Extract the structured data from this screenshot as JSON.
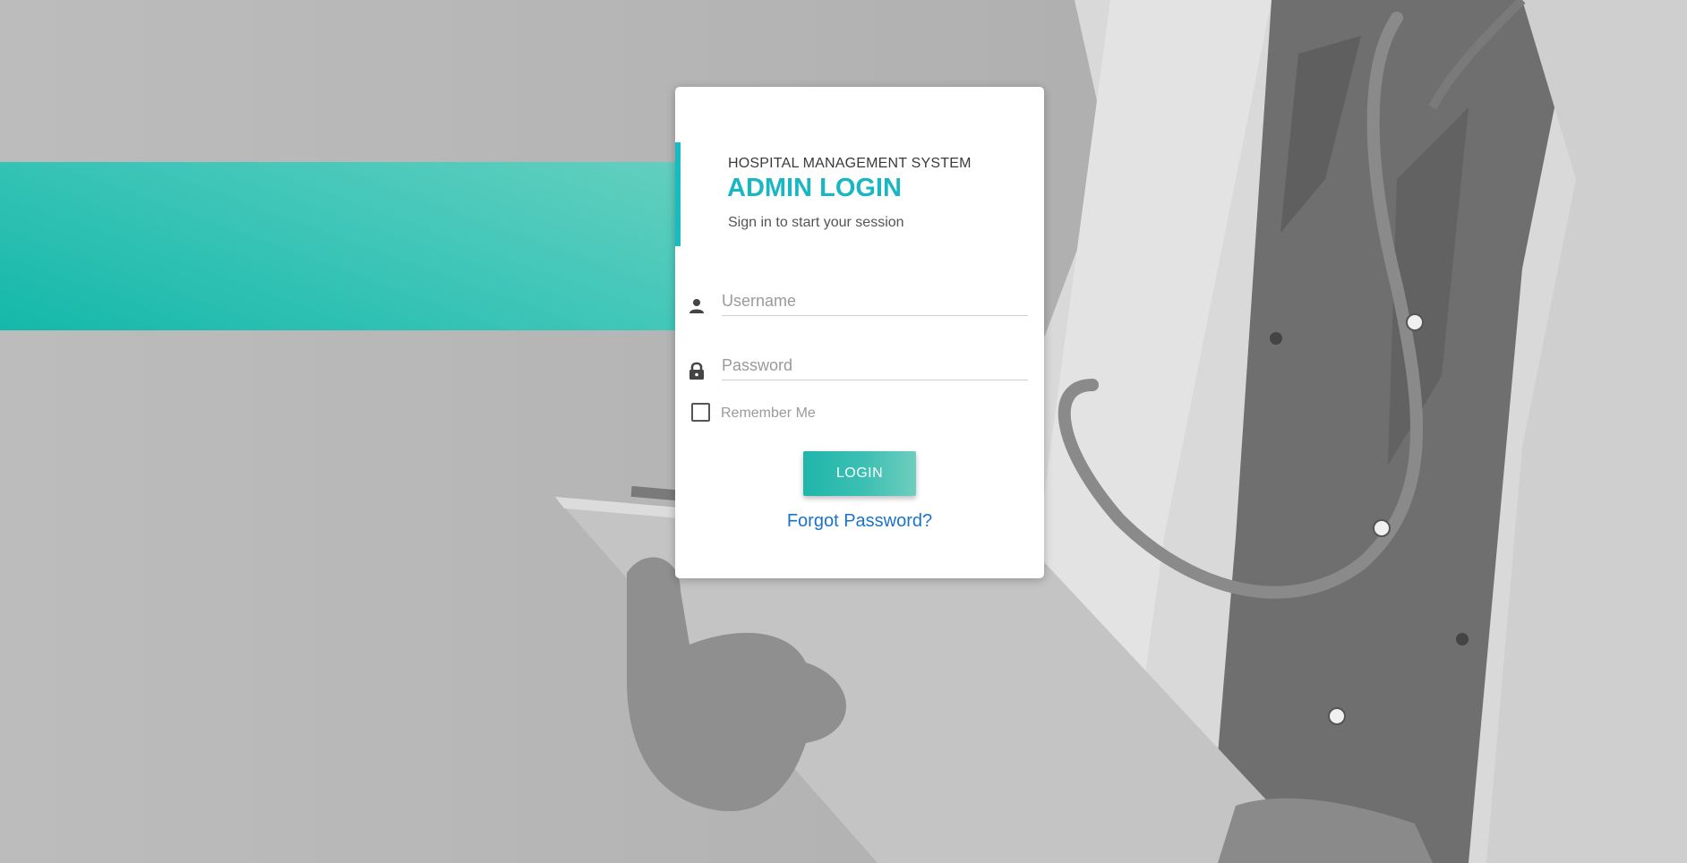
{
  "background": {
    "accent_color": "#1ab7c3",
    "band_color": "#3fc6b8"
  },
  "login": {
    "system_name": "HOSPITAL MANAGEMENT SYSTEM",
    "title": "ADMIN LOGIN",
    "session_text": "Sign in to start your session",
    "username_placeholder": "Username",
    "username_icon": "person-icon",
    "password_placeholder": "Password",
    "password_icon": "lock-icon",
    "remember_label": "Remember Me",
    "remember_checked": false,
    "login_button": "LOGIN",
    "forgot_link": "Forgot Password?"
  }
}
